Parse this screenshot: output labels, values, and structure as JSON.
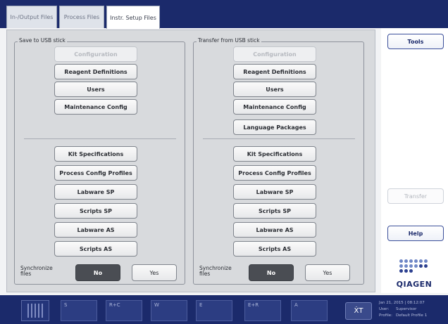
{
  "tabs": [
    {
      "label": "In-/Output Files"
    },
    {
      "label": "Process Files"
    },
    {
      "label": "Instr. Setup Files"
    }
  ],
  "save_group": {
    "legend": "Save to USB stick",
    "buttons": [
      "Configuration",
      "Reagent Definitions",
      "Users",
      "Maintenance Config",
      "Kit Specifications",
      "Process Config Profiles",
      "Labware SP",
      "Scripts SP",
      "Labware AS",
      "Scripts AS"
    ],
    "sync_label_1": "Synchronize",
    "sync_label_2": "files",
    "no": "No",
    "yes": "Yes"
  },
  "transfer_group": {
    "legend": "Transfer from USB stick",
    "buttons": [
      "Configuration",
      "Reagent Definitions",
      "Users",
      "Maintenance Config",
      "Language Packages",
      "Kit Specifications",
      "Process Config Profiles",
      "Labware SP",
      "Scripts SP",
      "Labware AS",
      "Scripts AS"
    ],
    "sync_label_1": "Synchronize",
    "sync_label_2": "files",
    "no": "No",
    "yes": "Yes"
  },
  "sidebar": {
    "tools": "Tools",
    "transfer": "Transfer",
    "help": "Help",
    "logo": "QIAGEN"
  },
  "bottom": {
    "slots": [
      "S",
      "R+C",
      "W",
      "E",
      "E+R",
      "A"
    ],
    "tool_icon": "ẊT",
    "datetime": "Jan 21, 2015 | 08:12:07",
    "user_key": "User:",
    "user_val": "Supervisor",
    "profile_key": "Profile:",
    "profile_val": "Default Profile 1"
  },
  "colors": {
    "brand": "#1b2a6b",
    "toggle_active": "#4a4d53"
  }
}
